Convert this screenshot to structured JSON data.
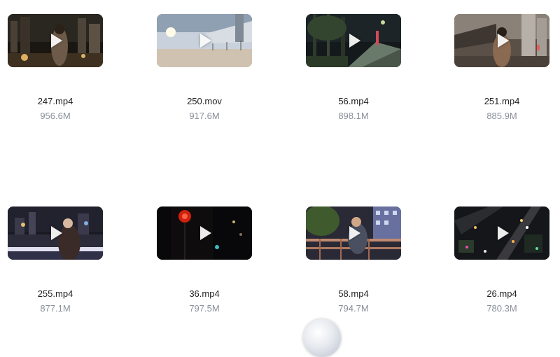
{
  "files": [
    {
      "name": "247.mp4",
      "size": "956.6M",
      "thumbnail": "video-thumbnail-night-city-woman-icon"
    },
    {
      "name": "250.mov",
      "size": "917.6M",
      "thumbnail": "video-thumbnail-sunset-pier-icon"
    },
    {
      "name": "56.mp4",
      "size": "898.1M",
      "thumbnail": "video-thumbnail-night-path-trees-icon"
    },
    {
      "name": "251.mp4",
      "size": "885.9M",
      "thumbnail": "video-thumbnail-woman-skyscraper-icon"
    },
    {
      "name": "255.mp4",
      "size": "877.1M",
      "thumbnail": "video-thumbnail-woman-riverside-night-icon"
    },
    {
      "name": "36.mp4",
      "size": "797.5M",
      "thumbnail": "video-thumbnail-traffic-light-night-icon"
    },
    {
      "name": "58.mp4",
      "size": "794.7M",
      "thumbnail": "video-thumbnail-man-railing-icon"
    },
    {
      "name": "26.mp4",
      "size": "780.3M",
      "thumbnail": "video-thumbnail-aerial-city-night-icon"
    }
  ]
}
